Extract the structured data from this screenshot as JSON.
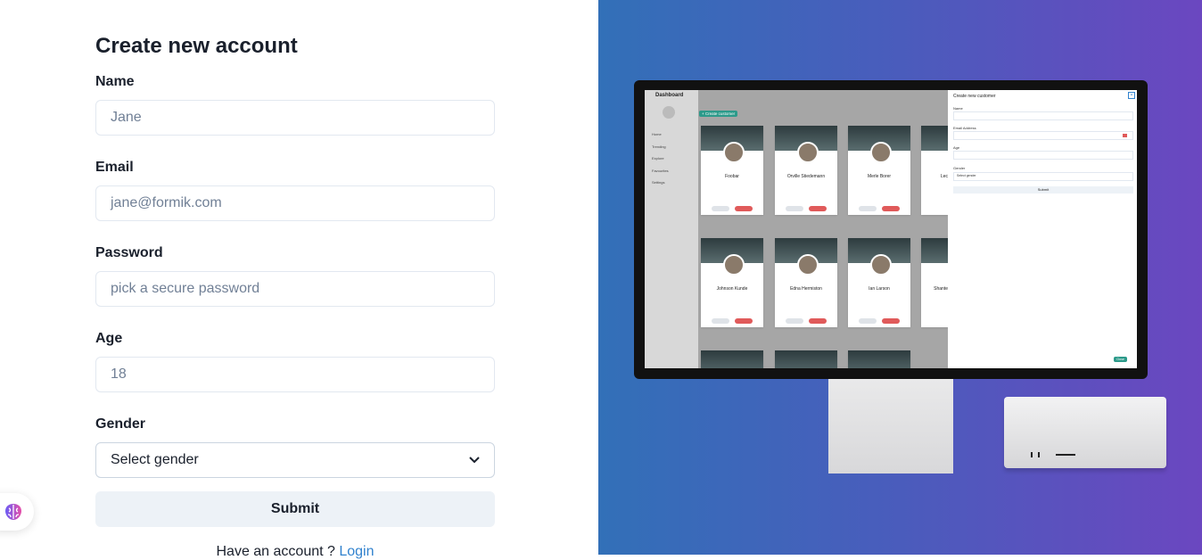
{
  "form": {
    "title": "Create new account",
    "name_label": "Name",
    "name_placeholder": "Jane",
    "email_label": "Email",
    "email_placeholder": "jane@formik.com",
    "password_label": "Password",
    "password_placeholder": "pick a secure password",
    "age_label": "Age",
    "age_placeholder": "18",
    "gender_label": "Gender",
    "gender_selected": "Select gender",
    "submit_label": "Submit",
    "signin_text": "Have an account ?",
    "signin_link": "Login"
  },
  "mockup": {
    "dashboard_title": "Dashboard",
    "create_button": "+ Create customer",
    "nav": [
      "Home",
      "Trending",
      "Explore",
      "Favourites",
      "Settings"
    ],
    "cards_row1": [
      "Foobar",
      "Orville Stiedemann",
      "Merle Borer",
      "Lec"
    ],
    "cards_row2": [
      "Johnson Kunde",
      "Edna Hermiston",
      "Ian Larson",
      "Shante"
    ],
    "drawer_title": "Create new customer",
    "drawer_name": "Name",
    "drawer_email": "Email Address",
    "drawer_age": "Age",
    "drawer_gender": "Gender",
    "drawer_select": "Select gender",
    "drawer_submit": "Submit",
    "drawer_close": "Close"
  },
  "colors": {
    "link": "#3182ce",
    "gradient_start": "#3270b8",
    "gradient_end": "#6b47c0"
  }
}
